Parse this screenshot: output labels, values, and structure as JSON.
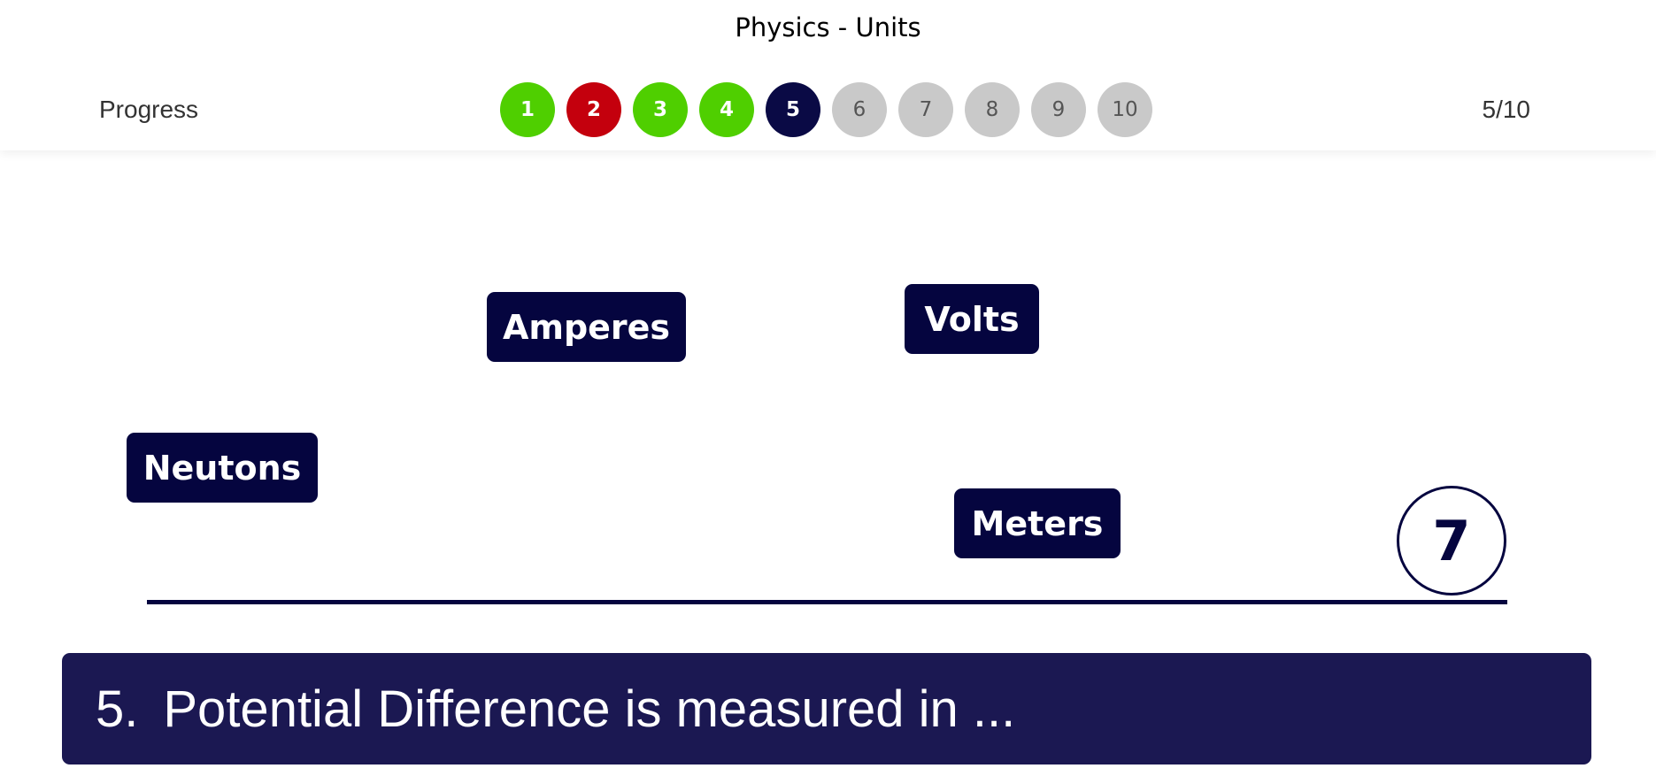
{
  "header": {
    "title": "Physics - Units",
    "progress_label": "Progress",
    "progress_count": "5/10",
    "steps": [
      {
        "label": "1",
        "state": "correct"
      },
      {
        "label": "2",
        "state": "wrong"
      },
      {
        "label": "3",
        "state": "correct"
      },
      {
        "label": "4",
        "state": "correct"
      },
      {
        "label": "5",
        "state": "current"
      },
      {
        "label": "6",
        "state": "pending"
      },
      {
        "label": "7",
        "state": "pending"
      },
      {
        "label": "8",
        "state": "pending"
      },
      {
        "label": "9",
        "state": "pending"
      },
      {
        "label": "10",
        "state": "pending"
      }
    ]
  },
  "answers": {
    "amperes": "Amperes",
    "volts": "Volts",
    "neutons": "Neutons",
    "meters": "Meters"
  },
  "timer": "7",
  "question": {
    "number": "5.",
    "text": "Potential Difference is measured in ..."
  },
  "colors": {
    "correct": "#4fcf00",
    "wrong": "#c4000d",
    "current": "#0a0a45",
    "pending": "#c9c9c9",
    "tile": "#05053f",
    "question_bar": "#1b1852"
  }
}
